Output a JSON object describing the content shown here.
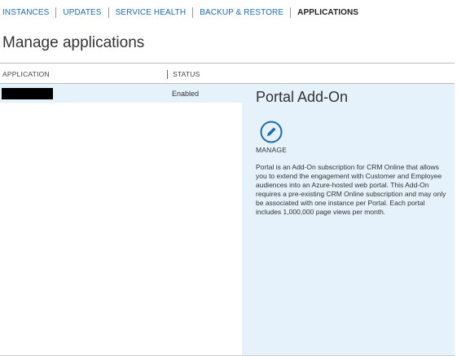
{
  "nav": {
    "items": [
      {
        "label": "INSTANCES",
        "active": false
      },
      {
        "label": "UPDATES",
        "active": false
      },
      {
        "label": "SERVICE HEALTH",
        "active": false
      },
      {
        "label": "BACKUP & RESTORE",
        "active": false
      },
      {
        "label": "APPLICATIONS",
        "active": true
      }
    ]
  },
  "page": {
    "title": "Manage applications"
  },
  "table": {
    "columns": [
      "APPLICATION",
      "STATUS"
    ],
    "rows": [
      {
        "application": "",
        "status": "Enabled",
        "selected": true
      }
    ]
  },
  "detail": {
    "title": "Portal Add-On",
    "manage_label": "MANAGE",
    "manage_icon": "pencil-icon",
    "description": "Portal is an Add-On subscription for CRM Online that allows you to extend the engagement with Customer and Employee audiences into an Azure-hosted web portal. This Add-On requires a pre-existing CRM Online subscription and may only be associated with one instance per Portal. Each portal includes 1,000,000 page views per month."
  },
  "colors": {
    "link": "#1c6bb0",
    "selection": "#e5f1fb",
    "icon": "#1c6bb0"
  }
}
